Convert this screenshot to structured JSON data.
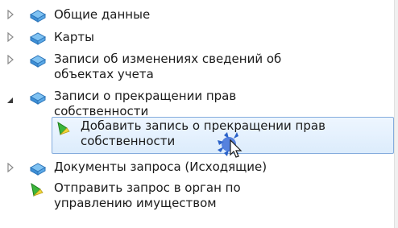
{
  "tree": {
    "items": [
      {
        "label_lines": [
          "Общие данные"
        ],
        "expander": "collapsed",
        "icon": "folder-book-icon"
      },
      {
        "label_lines": [
          "Карты"
        ],
        "expander": "collapsed",
        "icon": "folder-book-icon"
      },
      {
        "label_lines": [
          "Записи об изменениях сведений об",
          "объектах учета"
        ],
        "expander": "collapsed",
        "icon": "folder-book-icon"
      },
      {
        "label_lines": [
          "Записи о прекращении прав",
          "собственности"
        ],
        "expander": "expanded",
        "icon": "folder-book-icon"
      },
      {
        "label_lines": [
          "Добавить запись о прекращении прав",
          "собственности"
        ],
        "expander": "none",
        "icon": "green-arrow-action-icon",
        "selected": true
      },
      {
        "label_lines": [
          "Документы запроса (Исходящие)"
        ],
        "expander": "collapsed",
        "icon": "folder-book-icon"
      },
      {
        "label_lines": [
          "Отправить запрос в орган по",
          "управлению имуществом"
        ],
        "expander": "none",
        "icon": "green-arrow-action-icon"
      }
    ]
  },
  "colors": {
    "selection_border": "#84acdd",
    "selection_fill": "#dcecfc",
    "folder_icon": "#3d8fd6",
    "action_icon": "#3bb53b"
  }
}
